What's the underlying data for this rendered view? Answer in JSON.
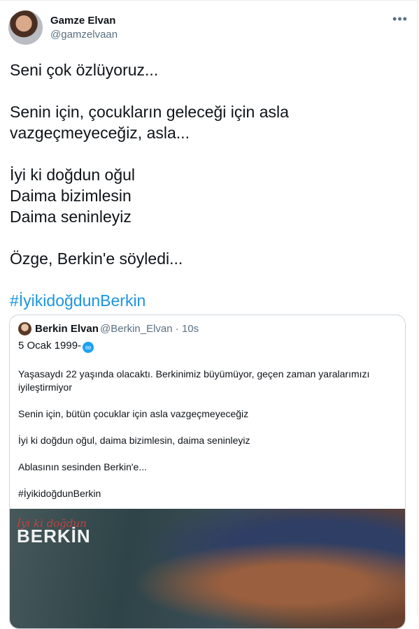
{
  "author": {
    "name": "Gamze Elvan",
    "handle": "@gamzelvaan"
  },
  "more_glyph": "•••",
  "tweet_lines": [
    "Seni çok özlüyoruz...",
    "",
    "Senin için, çocukların geleceği için asla",
    "vazgeçmeyeceğiz, asla...",
    "",
    "İyi ki doğdun oğul",
    "Daima bizimlesin",
    "Daima seninleyiz",
    "",
    "Özge, Berkin'e söyledi...",
    ""
  ],
  "hashtag": "#İyikidoğdunBerkin",
  "quoted": {
    "name": "Berkin Elvan",
    "handle_time": "@Berkin_Elvan · 10s",
    "date": "5 Ocak 1999-",
    "badge_glyph": "∞",
    "paragraphs": [
      "Yaşasaydı 22 yaşında olacaktı. Berkinimiz büyümüyor, geçen zaman yaralarımızı iyileştirmiyor",
      "Senin için, bütün çocuklar için asla vazgeçmeyeceğiz",
      "İyi ki doğdun oğul, daima bizimlesin, daima seninleyiz",
      "Ablasının sesinden Berkin'e...",
      "#İyikidoğdunBerkin"
    ],
    "media": {
      "script_text": "İyi ki doğdun",
      "title_text": "BERKİN"
    }
  },
  "colors": {
    "link": "#1b95e0",
    "muted": "#5b7083",
    "border": "#ccd6dd",
    "badge": "#1da1f2"
  }
}
